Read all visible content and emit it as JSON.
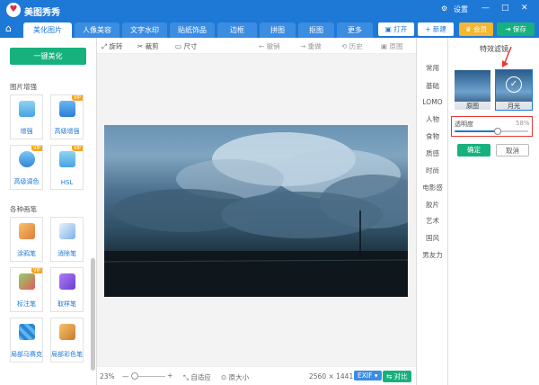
{
  "app": {
    "name": "美图秀秀",
    "logo": "♥",
    "settings": "设置",
    "min": "—",
    "max": "□",
    "close": "✕"
  },
  "tabs": [
    "美化图片",
    "人像美容",
    "文字水印",
    "贴纸饰品",
    "边框",
    "拼图",
    "抠图",
    "更多"
  ],
  "header_buttons": {
    "open": "打开",
    "new": "新建",
    "vip": "会员",
    "save": "保存"
  },
  "sidebar": {
    "one_key": "一键美化",
    "section_enhance": "图片增强",
    "enhance_tools": [
      {
        "label": "增强",
        "vip": false
      },
      {
        "label": "高级增强",
        "vip": true
      },
      {
        "label": "高级调色",
        "vip": true
      },
      {
        "label": "HSL",
        "vip": true
      }
    ],
    "section_brush": "各种画笔",
    "brush_tools": [
      {
        "label": "涂鸦笔",
        "vip": false
      },
      {
        "label": "消除笔",
        "vip": false
      },
      {
        "label": "标注笔",
        "vip": true
      },
      {
        "label": "取样笔",
        "vip": false
      },
      {
        "label": "局部马赛克",
        "vip": false
      },
      {
        "label": "局部彩色笔",
        "vip": false
      }
    ],
    "vip_badge": "VIP"
  },
  "toolbar": {
    "rotate": "旋转",
    "crop": "裁剪",
    "resize": "尺寸",
    "undo": "撤销",
    "redo": "重做",
    "history": "历史",
    "original": "原图"
  },
  "status": {
    "zoom": "23%",
    "fit": "自适应",
    "actual": "原大小",
    "dimensions": "2560 × 1441",
    "exif": "EXIF",
    "compare": "对比"
  },
  "filter_categories": [
    "常用",
    "基础",
    "LOMO",
    "人物",
    "食物",
    "质感",
    "时尚",
    "电影感",
    "胶片",
    "艺术",
    "国风",
    "男友力"
  ],
  "effects": {
    "title": "特效滤镜",
    "thumb_original": "原图",
    "thumb_moonlight": "月光",
    "opacity_label": "透明度",
    "opacity_value": "58%",
    "opacity": 0.58,
    "confirm": "确定",
    "cancel": "取消"
  },
  "colors": {
    "brand": "#1e78d6",
    "green": "#17b17e",
    "highlight": "#e53935",
    "vip": "#f5a623"
  }
}
